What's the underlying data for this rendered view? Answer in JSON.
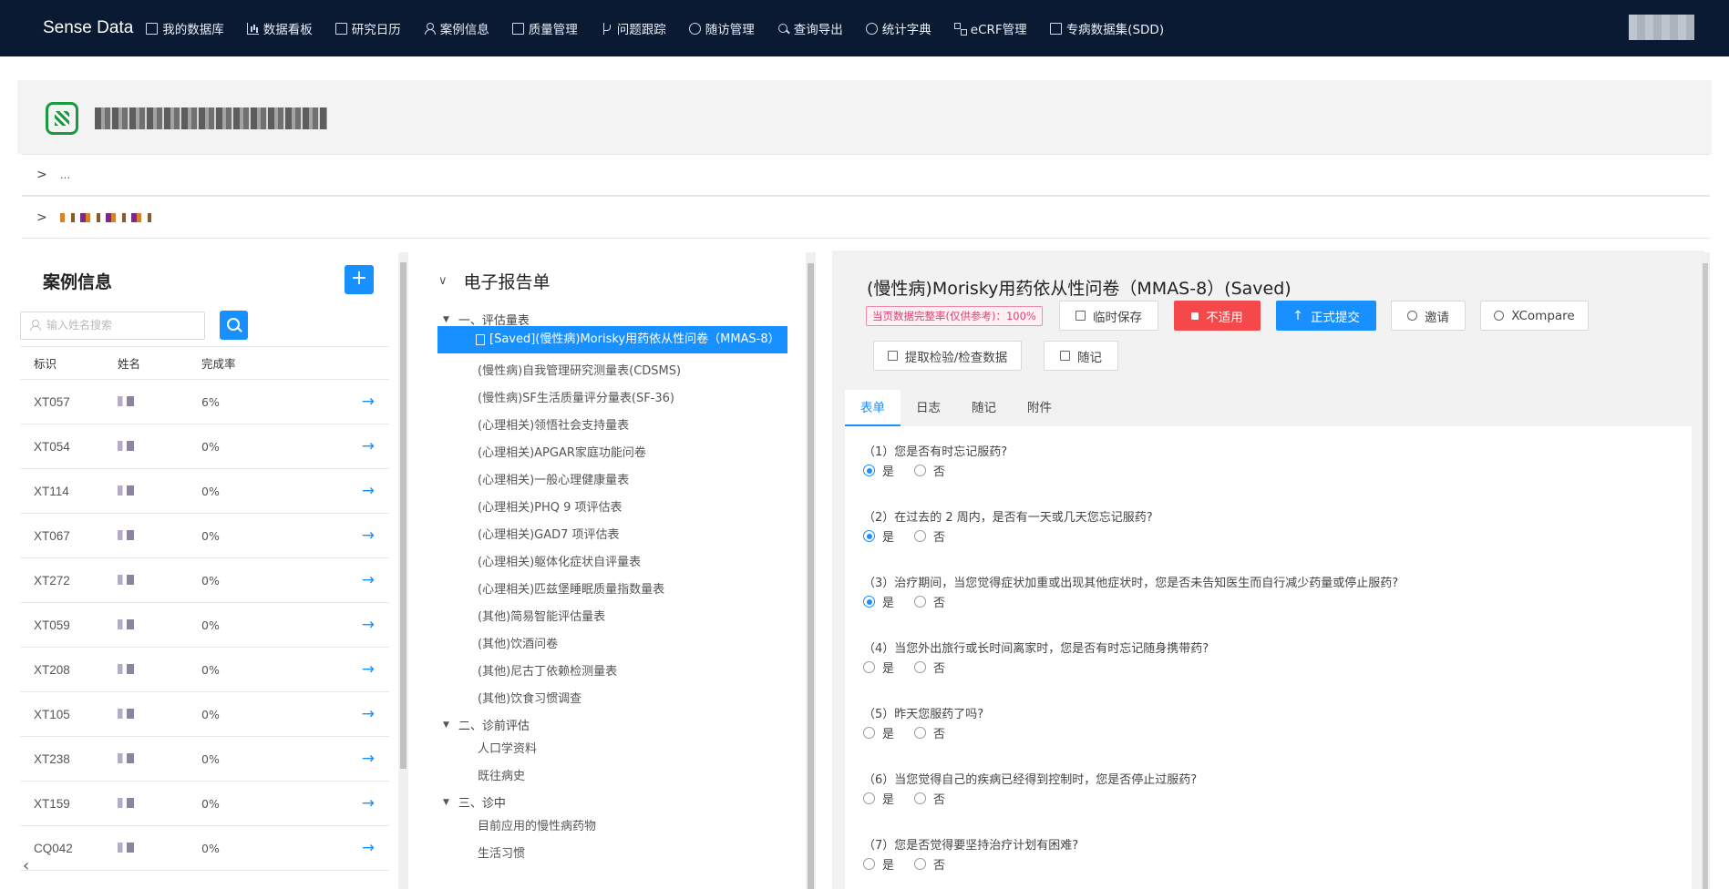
{
  "nav": {
    "brand": "Sense Data",
    "items": [
      {
        "label": "我的数据库",
        "icon": "database-icon"
      },
      {
        "label": "数据看板",
        "icon": "bar-chart-icon"
      },
      {
        "label": "研究日历",
        "icon": "calendar-icon"
      },
      {
        "label": "案例信息",
        "icon": "user-icon"
      },
      {
        "label": "质量管理",
        "icon": "quality-check-icon"
      },
      {
        "label": "问题跟踪",
        "icon": "branch-icon"
      },
      {
        "label": "随访管理",
        "icon": "clock-icon"
      },
      {
        "label": "查询导出",
        "icon": "search-icon"
      },
      {
        "label": "统计字典",
        "icon": "link-icon"
      },
      {
        "label": "eCRF管理",
        "icon": "grid-icon"
      },
      {
        "label": "专病数据集(SDD)",
        "icon": "document-icon"
      }
    ]
  },
  "header": {
    "row1_label": "...",
    "row2_label": ""
  },
  "cases": {
    "title": "案例信息",
    "add_label": "+",
    "search_placeholder": "输入姓名搜索",
    "columns": [
      "标识",
      "姓名",
      "完成率"
    ],
    "rows": [
      {
        "id": "XT057",
        "rate": "6%"
      },
      {
        "id": "XT054",
        "rate": "0%"
      },
      {
        "id": "XT114",
        "rate": "0%"
      },
      {
        "id": "XT067",
        "rate": "0%"
      },
      {
        "id": "XT272",
        "rate": "0%"
      },
      {
        "id": "XT059",
        "rate": "0%"
      },
      {
        "id": "XT208",
        "rate": "0%"
      },
      {
        "id": "XT105",
        "rate": "0%"
      },
      {
        "id": "XT238",
        "rate": "0%"
      },
      {
        "id": "XT159",
        "rate": "0%"
      },
      {
        "id": "CQ042",
        "rate": "0%"
      }
    ]
  },
  "tree": {
    "title": "电子报告单",
    "groups": [
      {
        "label": "一、评估量表",
        "items": [
          "[Saved](慢性病)Morisky用药依从性问卷（MMAS-8）",
          "(慢性病)自我管理研究测量表(CDSMS)",
          "(慢性病)SF生活质量评分量表(SF-36)",
          "(心理相关)领悟社会支持量表",
          "(心理相关)APGAR家庭功能问卷",
          "(心理相关)一般心理健康量表",
          "(心理相关)PHQ 9 项评估表",
          "(心理相关)GAD7 项评估表",
          "(心理相关)躯体化症状自评量表",
          "(心理相关)匹兹堡睡眠质量指数量表",
          "(其他)简易智能评估量表",
          "(其他)饮酒问卷",
          "(其他)尼古丁依赖检测量表",
          "(其他)饮食习惯调查"
        ]
      },
      {
        "label": "二、诊前评估",
        "items": [
          "人口学资料",
          "既往病史"
        ]
      },
      {
        "label": "三、诊中",
        "items": [
          "目前应用的慢性病药物",
          "生活习惯"
        ]
      }
    ]
  },
  "form": {
    "title": "(慢性病)Morisky用药依从性问卷（MMAS-8）(Saved)",
    "completeness": "当页数据完整率(仅供参考)：100%",
    "buttons": {
      "temp_save": "临时保存",
      "not_applicable": "不适用",
      "submit": "正式提交",
      "invite": "邀请",
      "xcompare": "XCompare",
      "fetch": "提取检验/检查数据",
      "note": "随记"
    },
    "tabs": [
      "表单",
      "日志",
      "随记",
      "附件"
    ],
    "yes": "是",
    "no": "否",
    "questions": [
      {
        "text": "（1）您是否有时忘记服药?",
        "answer": "yes"
      },
      {
        "text": "（2）在过去的 2 周内，是否有一天或几天您忘记服药?",
        "answer": "yes"
      },
      {
        "text": "（3）治疗期间，当您觉得症状加重或出现其他症状时，您是否未告知医生而自行减少药量或停止服药?",
        "answer": "yes"
      },
      {
        "text": "（4）当您外出旅行或长时间离家时，您是否有时忘记随身携带药?",
        "answer": "none"
      },
      {
        "text": "（5）昨天您服药了吗?",
        "answer": "none"
      },
      {
        "text": "（6）当您觉得自己的疾病已经得到控制时，您是否停止过服药?",
        "answer": "none"
      },
      {
        "text": "（7）您是否觉得要坚持治疗计划有困难?",
        "answer": "none"
      }
    ]
  }
}
